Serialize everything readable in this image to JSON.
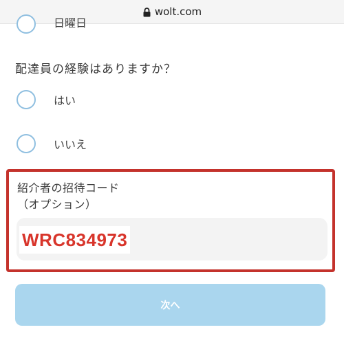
{
  "browser": {
    "url_text": "wolt.com",
    "lock_icon": "lock-icon"
  },
  "form": {
    "previous_option_label": "日曜日",
    "question": "配達員の経験はありますか？",
    "options": [
      {
        "label": "はい"
      },
      {
        "label": "いいえ"
      }
    ],
    "referral": {
      "label_line1": "紹介者の招待コード",
      "label_line2": "（オプション）",
      "value": "WRC834973"
    },
    "next_button_label": "次へ"
  },
  "colors": {
    "radio_border": "#8fbfe0",
    "highlight_border": "#c4322c",
    "code_text": "#d8352b",
    "button_bg": "#aad6ee"
  }
}
